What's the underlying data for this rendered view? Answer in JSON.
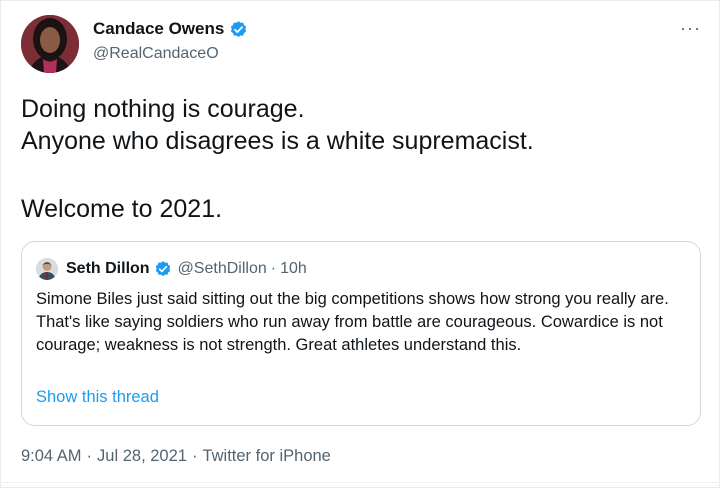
{
  "tweet": {
    "author": {
      "display_name": "Candace Owens",
      "handle": "@RealCandaceO",
      "verified": true,
      "avatar_icon": "avatar-portrait"
    },
    "more_label": "···",
    "text_lines": [
      "Doing nothing is courage.",
      "Anyone who disagrees is a white supremacist.",
      "",
      "Welcome to 2021."
    ],
    "quoted": {
      "display_name": "Seth Dillon",
      "handle": "@SethDillon",
      "separator": "·",
      "time": "10h",
      "verified": true,
      "text": "Simone Biles just said sitting out the big competitions shows how strong you really are. That's like saying soldiers who run away from battle are courageous. Cowardice is not courage; weakness is not strength. Great athletes understand this.",
      "show_thread_label": "Show this thread"
    },
    "meta": {
      "time": "9:04 AM",
      "date": "Jul 28, 2021",
      "source": "Twitter for iPhone",
      "separator": "·"
    }
  },
  "colors": {
    "accent": "#1d9bf0",
    "text": "#0f1419",
    "secondary": "#536471",
    "border": "#cfd9de"
  }
}
